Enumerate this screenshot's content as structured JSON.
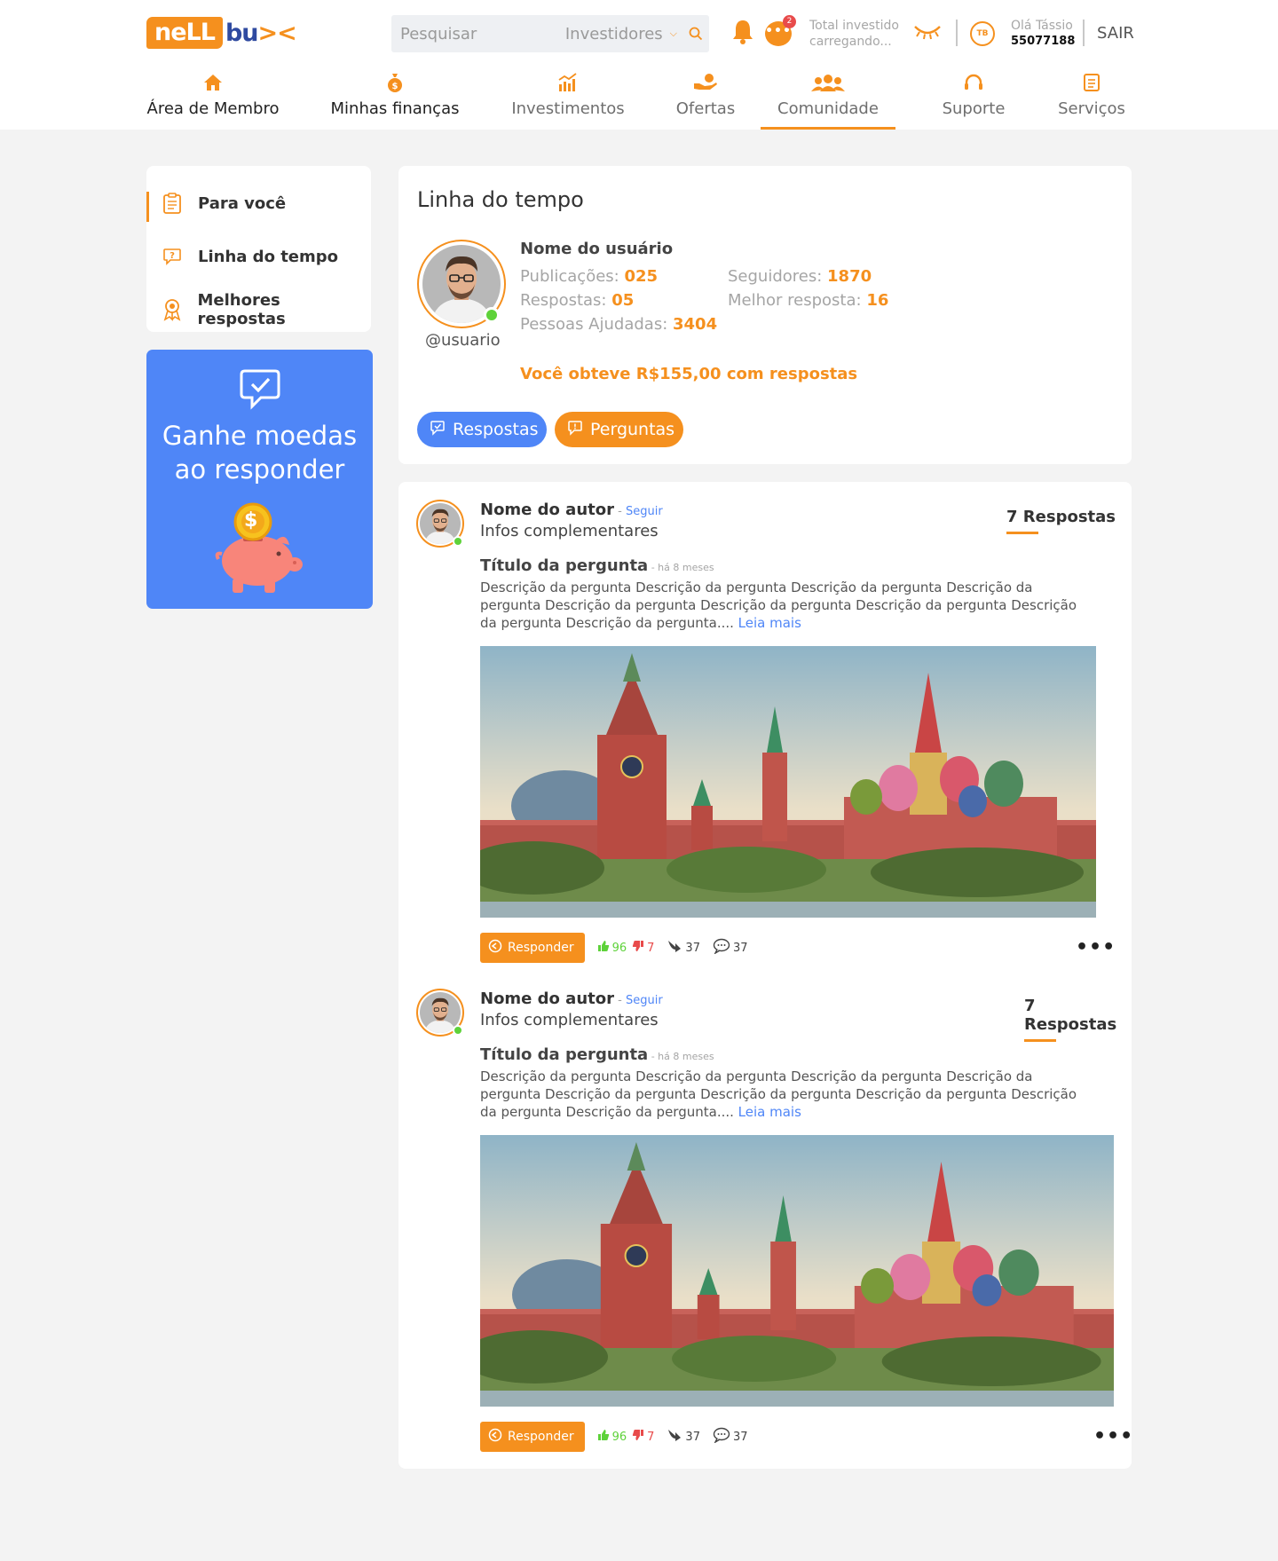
{
  "brand": {
    "logo_left": "neLL",
    "logo_right": "bu",
    "logo_arrow": "><"
  },
  "header": {
    "search_placeholder": "Pesquisar",
    "search_scope": "Investidores",
    "chat_badge": "2",
    "invest_line1": "Total investido",
    "invest_line2": "carregando...",
    "avatar_initials": "TB",
    "greeting": "Olá Tássio",
    "account_number": "55077188",
    "logout_label": "SAIR"
  },
  "nav": {
    "items": [
      {
        "label": "Área de Membro",
        "icon": "home-icon"
      },
      {
        "label": "Minhas finanças",
        "icon": "money-bag-icon"
      },
      {
        "label": "Investimentos",
        "icon": "chart-icon"
      },
      {
        "label": "Ofertas",
        "icon": "hand-coin-icon"
      },
      {
        "label": "Comunidade",
        "icon": "people-icon"
      },
      {
        "label": "Suporte",
        "icon": "headset-icon"
      },
      {
        "label": "Serviços",
        "icon": "document-icon"
      }
    ],
    "active_index": 4
  },
  "sidebar": {
    "items": [
      {
        "label": "Para você",
        "icon": "clipboard-icon"
      },
      {
        "label": "Linha do tempo",
        "icon": "question-bubble-icon"
      },
      {
        "label": "Melhores respostas",
        "icon": "award-icon"
      }
    ],
    "active_index": 0
  },
  "promo": {
    "line1": "Ganhe moedas",
    "line2": "ao responder",
    "coin_symbol": "$"
  },
  "profile": {
    "title": "Linha do tempo",
    "user_name": "Nome do usuário",
    "handle": "@usuario",
    "stats": {
      "posts_label": "Publicações:",
      "posts_value": "025",
      "answers_label": "Respostas:",
      "answers_value": "05",
      "helped_label": "Pessoas Ajudadas:",
      "helped_value": "3404",
      "followers_label": "Seguidores:",
      "followers_value": "1870",
      "best_label": "Melhor resposta:",
      "best_value": "16"
    },
    "earned_text": "Você obteve R$155,00 com respostas",
    "btn_answers": "Respostas",
    "btn_questions": "Perguntas"
  },
  "posts": [
    {
      "author": "Nome do autor",
      "follow_sep": " - ",
      "follow": "Seguir",
      "infos": "Infos complementares",
      "answers_count": "7 Respostas",
      "question_title": "Título da pergunta",
      "ago": " - há 8 meses",
      "description": "Descrição da pergunta Descrição da pergunta Descrição da pergunta Descrição da pergunta Descrição da pergunta Descrição da pergunta Descrição da pergunta Descrição da pergunta Descrição da pergunta....",
      "read_more": "Leia mais",
      "reply_label": "Responder",
      "likes": "96",
      "dislikes": "7",
      "shares": "37",
      "comments": "37"
    },
    {
      "author": "Nome do autor",
      "follow_sep": " - ",
      "follow": "Seguir",
      "infos": "Infos complementares",
      "answers_count": "7 Respostas",
      "question_title": "Título da pergunta",
      "ago": " - há 8 meses",
      "description": "Descrição da pergunta Descrição da pergunta Descrição da pergunta Descrição da pergunta Descrição da pergunta Descrição da pergunta Descrição da pergunta Descrição da pergunta Descrição da pergunta....",
      "read_more": "Leia mais",
      "reply_label": "Responder",
      "likes": "96",
      "dislikes": "7",
      "shares": "37",
      "comments": "37"
    }
  ],
  "colors": {
    "accent": "#f5901e",
    "primary": "#4f86f7",
    "online": "#5ed23a",
    "danger": "#e84b4b",
    "background": "#f3f3f3"
  }
}
